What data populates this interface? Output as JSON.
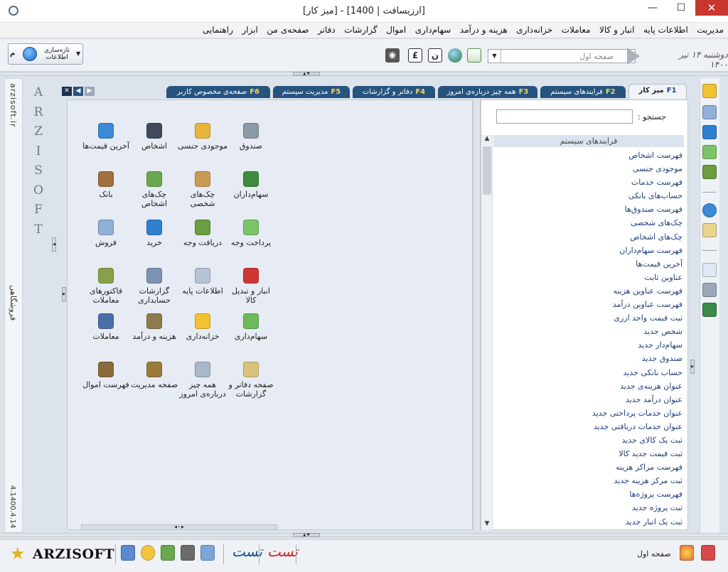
{
  "window": {
    "title": "[ارزیسافت | 1400] - [میز کار]",
    "minimize_label": "—",
    "maximize_label": "☐",
    "close_label": "✕"
  },
  "menu": [
    "مدیریت",
    "اطلاعات پایه",
    "انبار و کالا",
    "معاملات",
    "خزانه‌داری",
    "هزینه و درآمد",
    "سهام‌داری",
    "اموال",
    "گزارشات",
    "دفاتر",
    "صفحه‌ی من",
    "ابزار",
    "راهنمایی"
  ],
  "toolbar": {
    "refresh_label": "تازه‌سازی اطلاعات",
    "mode_badge": "م",
    "page_value": "صفحه اول",
    "date_text": "دوشنبه ۱۴ تیر ۱۴۰۰",
    "icons": [
      "binoculars-icon",
      "euro-icon",
      "nun-icon",
      "globe-icon",
      "chart-icon"
    ],
    "icon_glyphs": {
      "euro": "£",
      "nun": "ن"
    }
  },
  "left_strip": {
    "site": "arzisoft.ir",
    "section": "فروشگاهی",
    "version": "4.1400.4.14",
    "letters": [
      "A",
      "R",
      "Z",
      "I",
      "S",
      "O",
      "F",
      "T"
    ]
  },
  "tabs": [
    {
      "name": "میز کار",
      "key": "F1",
      "active": true
    },
    {
      "name": "فرایندهای سیستم",
      "key": "F2"
    },
    {
      "name": "همه چیز درباره‌ی امروز",
      "key": "F3"
    },
    {
      "name": "دفاتر و گزارشات",
      "key": "F4"
    },
    {
      "name": "مدیریت سیستم",
      "key": "F5"
    },
    {
      "name": "صفحه‌ی مخصوص کاربر",
      "key": "F6"
    }
  ],
  "tiles": [
    {
      "label": "صندوق",
      "color": "#8c9aa8"
    },
    {
      "label": "موجودی جنسی",
      "color": "#e7b53a"
    },
    {
      "label": "اشخاص",
      "color": "#3f4b5c"
    },
    {
      "label": "آخرین قیمت‌ها",
      "color": "#3b8ad8"
    },
    {
      "label": "سهام‌داران",
      "color": "#3e8d3e"
    },
    {
      "label": "چک‌های شخصی",
      "color": "#c99a54"
    },
    {
      "label": "چک‌های اشخاص",
      "color": "#6aa84f"
    },
    {
      "label": "بانک",
      "color": "#a07040"
    },
    {
      "label": "پرداخت وجه",
      "color": "#7cc46a"
    },
    {
      "label": "دریافت وجه",
      "color": "#6a9e3e"
    },
    {
      "label": "خرید",
      "color": "#2f80d0"
    },
    {
      "label": "فروش",
      "color": "#8fb0d8"
    },
    {
      "label": "انبار و تبدیل کالا",
      "color": "#d03535"
    },
    {
      "label": "اطلاعات پایه",
      "color": "#b6c4d6"
    },
    {
      "label": "گزارشات حسابداری",
      "color": "#7d92b4"
    },
    {
      "label": "فاکتورهای معاملات",
      "color": "#8a9f4a"
    },
    {
      "label": "سهام‌داری",
      "color": "#6cba5c"
    },
    {
      "label": "خزانه‌داری",
      "color": "#f2c230"
    },
    {
      "label": "هزینه و درآمد",
      "color": "#8d7a4e"
    },
    {
      "label": "معاملات",
      "color": "#4a6fa8"
    },
    {
      "label": "صفحه دفاتر و گزارشات",
      "color": "#d9c27a"
    },
    {
      "label": "همه چیز درباره‌ی امروز",
      "color": "#a9b8c8"
    },
    {
      "label": "صفحه مدیریت",
      "color": "#9a7a3a"
    },
    {
      "label": "فهرست اموال",
      "color": "#8a6a3a"
    }
  ],
  "process_panel": {
    "search_label": "جستجو :",
    "search_value": "",
    "list_header": "فرایندهای سیستم",
    "items": [
      "فهرست اشخاص",
      "موجودی جنسی",
      "فهرست خدمات",
      "حساب‌های بانکی",
      "فهرست صندوق‌ها",
      "چک‌های شخصی",
      "چک‌های اشخاص",
      "فهرست سهام‌داران",
      "آخرین قیمت‌ها",
      "عناوین ثابت",
      "فهرست عناوین هزینه",
      "فهرست عناوین درآمد",
      "ثبت قیمت واحد ارزی",
      "شخص جدید",
      "سهام‌دار جدید",
      "صندوق جدید",
      "حساب بانکی جدید",
      "عنوان هزینه‌ی جدید",
      "عنوان درآمد جدید",
      "عنوان خدمات پرداختی جدید",
      "عنوان خدمات دریافتی جدید",
      "ثبت یک کالای جدید",
      "ثبت قیمت جدید کالا",
      "فهرست مراکز هزینه",
      "ثبت مرکز هزینه جدید",
      "فهرست پروژه‌ها",
      "ثبت پروژه جدید",
      "ثبت یک انبار جدید"
    ]
  },
  "status": {
    "brand": "ARZISOFT",
    "text": "صفحه اول",
    "sig_1": "تست",
    "sig_2": "تست"
  },
  "colors": {
    "tab_bg": "#26547f",
    "tab_key": "#f7d54a",
    "link": "#1f3f7a",
    "panel_bg": "#e7ebf3"
  }
}
